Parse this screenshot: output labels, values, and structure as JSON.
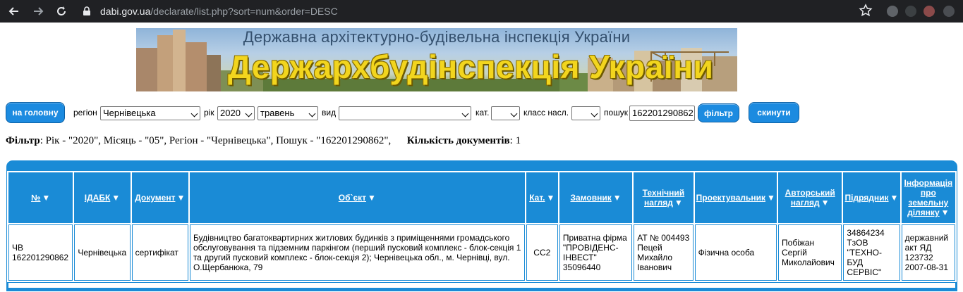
{
  "browser": {
    "url_host": "dabi.gov.ua",
    "url_path": "/declarate/list.php?sort=num&order=DESC"
  },
  "banner": {
    "subtitle": "Державна архітектурно-будівельна інспекція України",
    "title": "Держархбудінспекція України"
  },
  "filters": {
    "home_label": "на головну",
    "region_label": "регіон",
    "region_value": "Чернівецька",
    "year_label": "рік",
    "year_value": "2020",
    "month_value": "травень",
    "type_label": "вид",
    "type_value": "",
    "category_label": "кат.",
    "category_value": "",
    "class_label": "класс насл.",
    "class_value": "",
    "search_label": "пошук",
    "search_value": "162201290862",
    "filter_button": "фільтр",
    "reset_button": "скинути"
  },
  "summary": {
    "filter_label": "Фільтр",
    "filter_text": ": Рік - \"2020\", Місяць - \"05\", Регіон - \"Чернівецька\", Пошук - \"162201290862\",",
    "count_label": "Кількість документів",
    "count_text": ": 1"
  },
  "table": {
    "headers": [
      {
        "label": "№",
        "w": 91
      },
      {
        "label": "ІДАБК",
        "w": 79
      },
      {
        "label": "Документ",
        "w": 80
      },
      {
        "label": "Об`єкт",
        "w": 473
      },
      {
        "label": "Кат.",
        "w": 45
      },
      {
        "label": "Замовник",
        "w": 103
      },
      {
        "label": "Технічний нагляд",
        "w": 84
      },
      {
        "label": "Проектувальник",
        "w": 116
      },
      {
        "label": "Авторський нагляд",
        "w": 90
      },
      {
        "label": "Підрядник",
        "w": 80
      },
      {
        "label": "Інформація про земельну ділянку",
        "w": 76
      }
    ],
    "rows": [
      {
        "num": "ЧВ 162201290862",
        "idabk": "Чернівецька",
        "document": "сертифікат",
        "object": "Будівництво багатоквартирних житлових будинків з приміщеннями громадського обслуговування та підземним паркінгом (перший пусковий комплекс - блок-секція 1 та другий пусковий комплекс - блок-секція 2); Чернівецька обл., м. Чернівці, вул. О.Щербанюка, 79",
        "category": "СС2",
        "customer": "Приватна фірма \"ПРОВІДЕНС-ІНВЕСТ\" 35096440",
        "tech_supervision": "АТ № 004493 Пецей Михайло Іванович",
        "designer": "Фізична особа",
        "author_supervision": "Побіжан Сергій Миколайович",
        "contractor": "34864234 ТзОВ \"ТЕХНО-БУД СЕРВІС\"",
        "land_info": "державний акт ЯД 123732 2007-08-31"
      }
    ]
  },
  "colors": {
    "accent": "#1a8bd6",
    "button": "#1c8be0",
    "banner_title": "#f2d51e",
    "chrome_bg": "#202124"
  }
}
